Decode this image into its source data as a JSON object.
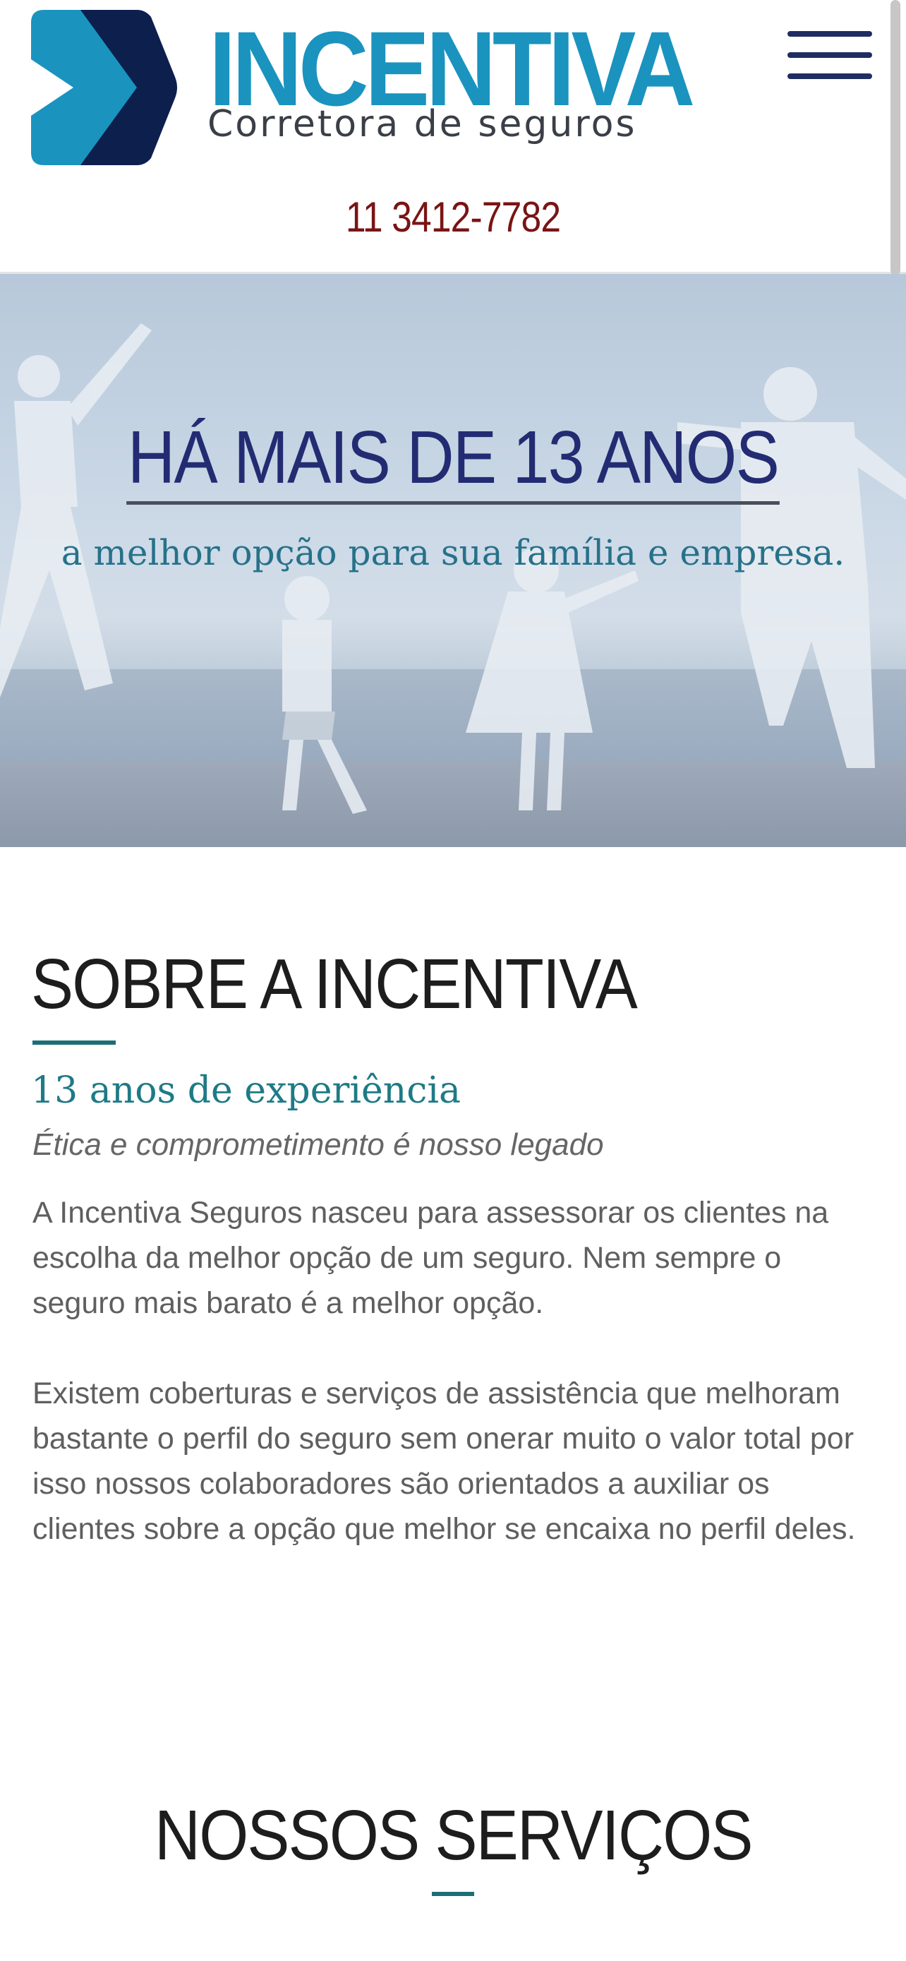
{
  "brand": {
    "name": "INCENTIVA",
    "tagline": "Corretora de seguros",
    "primary_color": "#1a93bf",
    "dark_color": "#0c1f4d"
  },
  "header": {
    "menu_icon": "hamburger-menu-icon",
    "phone": "11 3412-7782"
  },
  "hero": {
    "title": "HÁ MAIS DE 13 ANOS",
    "subtitle": "a melhor opção para sua família e empresa."
  },
  "about": {
    "title": "SOBRE A INCENTIVA",
    "subtitle": "13 anos de experiência",
    "tagline": "Ética e comprometimento é nosso legado",
    "paragraph1": "A Incentiva Seguros nasceu para assessorar os clientes na escolha da melhor opção de um seguro. Nem sempre o seguro mais barato é a melhor opção.",
    "paragraph2": "Existem coberturas e serviços de assistência que melhoram bastante o perfil do seguro sem onerar muito o valor total por isso nossos colaboradores são orientados a auxiliar os clientes sobre a opção que melhor se encaixa no perfil deles."
  },
  "services": {
    "title": "NOSSOS SERVIÇOS"
  }
}
